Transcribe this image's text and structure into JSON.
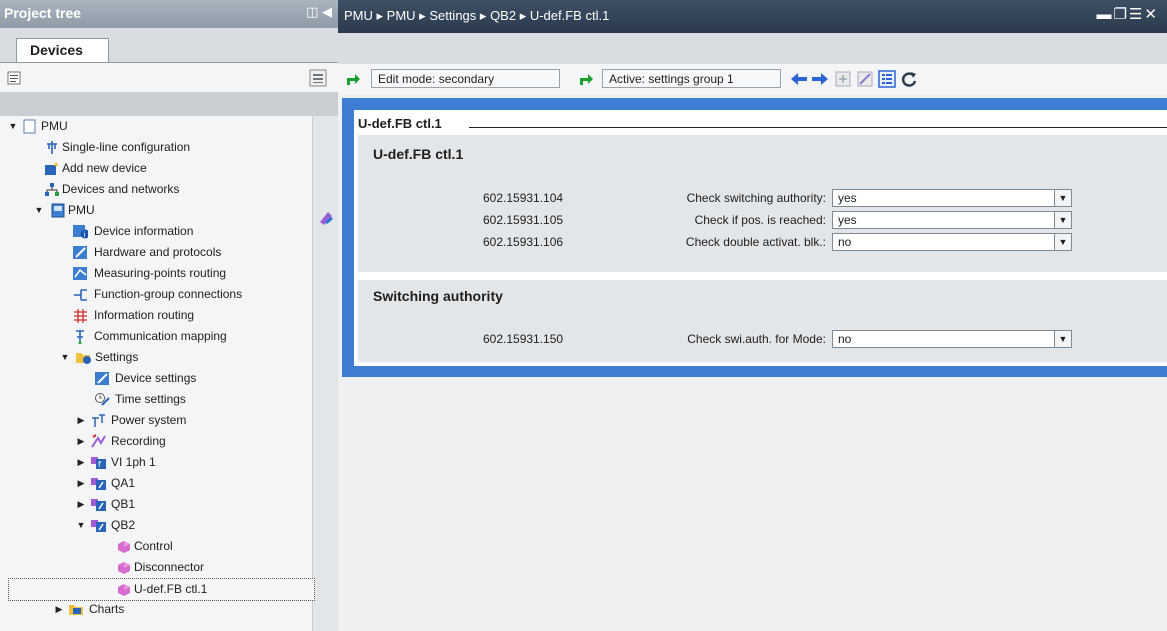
{
  "project_tree": {
    "title": "Project tree",
    "tab": "Devices",
    "items": [
      {
        "label": "PMU"
      },
      {
        "label": "Single-line configuration"
      },
      {
        "label": "Add new device"
      },
      {
        "label": "Devices and networks"
      },
      {
        "label": "PMU"
      },
      {
        "label": "Device information"
      },
      {
        "label": "Hardware and protocols"
      },
      {
        "label": "Measuring-points routing"
      },
      {
        "label": "Function-group connections"
      },
      {
        "label": "Information routing"
      },
      {
        "label": "Communication mapping"
      },
      {
        "label": "Settings"
      },
      {
        "label": "Device settings"
      },
      {
        "label": "Time settings"
      },
      {
        "label": "Power system"
      },
      {
        "label": "Recording"
      },
      {
        "label": "VI 1ph 1"
      },
      {
        "label": "QA1"
      },
      {
        "label": "QB1"
      },
      {
        "label": "QB2"
      },
      {
        "label": "Control"
      },
      {
        "label": "Disconnector"
      },
      {
        "label": "U-def.FB ctl.1"
      },
      {
        "label": "Charts"
      }
    ]
  },
  "breadcrumb": [
    "PMU",
    "PMU",
    "Settings",
    "QB2",
    "U-def.FB ctl.1"
  ],
  "toolbar": {
    "edit_mode": "Edit mode: secondary",
    "active_group": "Active: settings group 1"
  },
  "editor": {
    "panel_title": "U-def.FB ctl.1",
    "groups": [
      {
        "title": "U-def.FB ctl.1",
        "params": [
          {
            "address": "602.15931.104",
            "label": "Check switching authority:",
            "value": "yes"
          },
          {
            "address": "602.15931.105",
            "label": "Check if pos. is reached:",
            "value": "yes"
          },
          {
            "address": "602.15931.106",
            "label": "Check double activat. blk.:",
            "value": "no"
          }
        ]
      },
      {
        "title": "Switching authority",
        "params": [
          {
            "address": "602.15931.150",
            "label": "Check swi.auth. for Mode:",
            "value": "no"
          }
        ]
      }
    ]
  },
  "icons": [
    "tree-arrow-icon",
    "folder-icon",
    "device-icon",
    "settings-icon",
    "function-group-icon",
    "function-block-icon",
    "back-arrow-icon",
    "forward-arrow-icon",
    "refresh-icon"
  ],
  "colors": {
    "frame_blue": "#3e7dd1",
    "header_dark": "#2b3b4d",
    "selection_arrow_green": "#1a9e2e"
  }
}
